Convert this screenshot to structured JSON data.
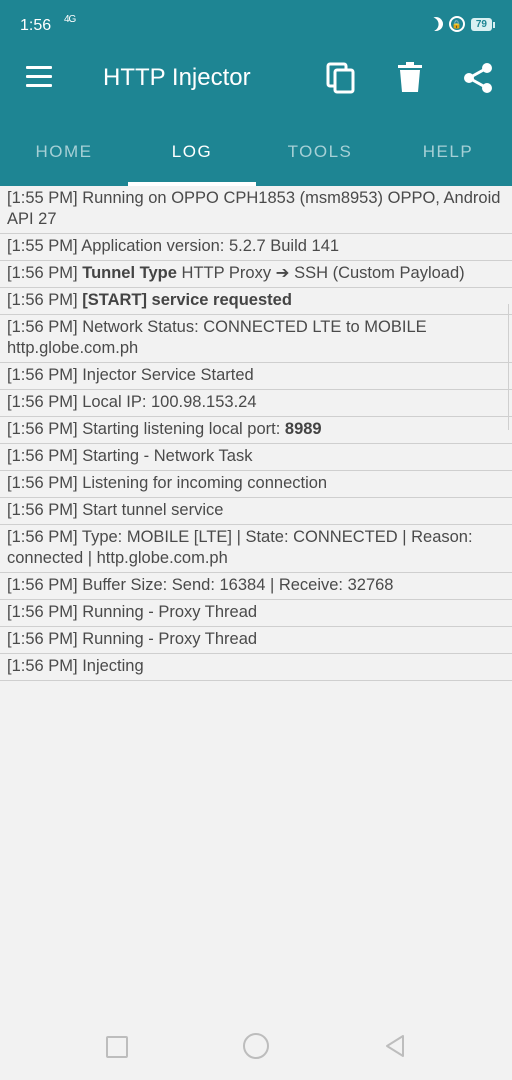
{
  "status_bar": {
    "time": "1:56",
    "network": "4G",
    "battery": "79"
  },
  "app_bar": {
    "title": "HTTP Injector"
  },
  "tabs": [
    {
      "label": "HOME"
    },
    {
      "label": "LOG"
    },
    {
      "label": "TOOLS"
    },
    {
      "label": "HELP"
    }
  ],
  "active_tab": "LOG",
  "log": [
    {
      "time": "[1:55 PM]",
      "parts": [
        {
          "text": " Running on OPPO CPH1853 (msm8953) OPPO, Android API 27"
        }
      ]
    },
    {
      "time": "[1:55 PM]",
      "parts": [
        {
          "text": " Application version: 5.2.7 Build 141"
        }
      ]
    },
    {
      "time": "[1:56 PM]",
      "parts": [
        {
          "text": " "
        },
        {
          "text": "Tunnel Type",
          "bold": true
        },
        {
          "text": " HTTP Proxy ➔ SSH (Custom Payload)"
        }
      ]
    },
    {
      "time": "[1:56 PM]",
      "parts": [
        {
          "text": " "
        },
        {
          "text": "[START] service requested",
          "bold": true
        }
      ]
    },
    {
      "time": "[1:56 PM]",
      "parts": [
        {
          "text": " Network Status: CONNECTED LTE to MOBILE http.globe.com.ph"
        }
      ]
    },
    {
      "time": "[1:56 PM]",
      "parts": [
        {
          "text": " Injector Service Started"
        }
      ]
    },
    {
      "time": "[1:56 PM]",
      "parts": [
        {
          "text": " Local IP: 100.98.153.24"
        }
      ]
    },
    {
      "time": "[1:56 PM]",
      "parts": [
        {
          "text": " Starting listening local port: "
        },
        {
          "text": "8989",
          "bold": true
        }
      ]
    },
    {
      "time": "[1:56 PM]",
      "parts": [
        {
          "text": " Starting - Network Task"
        }
      ]
    },
    {
      "time": "[1:56 PM]",
      "parts": [
        {
          "text": " Listening for incoming connection"
        }
      ]
    },
    {
      "time": "[1:56 PM]",
      "parts": [
        {
          "text": " Start tunnel service"
        }
      ]
    },
    {
      "time": "[1:56 PM]",
      "parts": [
        {
          "text": " Type: MOBILE [LTE] | State: CONNECTED | Reason: connected | http.globe.com.ph"
        }
      ]
    },
    {
      "time": "[1:56 PM]",
      "parts": [
        {
          "text": " Buffer Size: Send: 16384 | Receive: 32768"
        }
      ]
    },
    {
      "time": "[1:56 PM]",
      "parts": [
        {
          "text": " Running - Proxy Thread"
        }
      ]
    },
    {
      "time": "[1:56 PM]",
      "parts": [
        {
          "text": " Running - Proxy Thread"
        }
      ]
    },
    {
      "time": "[1:56 PM]",
      "parts": [
        {
          "text": " Injecting"
        }
      ]
    }
  ],
  "icons": {
    "menu": "menu-icon",
    "copy": "copy-icon",
    "delete": "trash-icon",
    "share": "share-icon"
  },
  "colors": {
    "primary": "#1e8593",
    "tab_inactive": "#a6d0d6",
    "background": "#f2f2f2"
  }
}
